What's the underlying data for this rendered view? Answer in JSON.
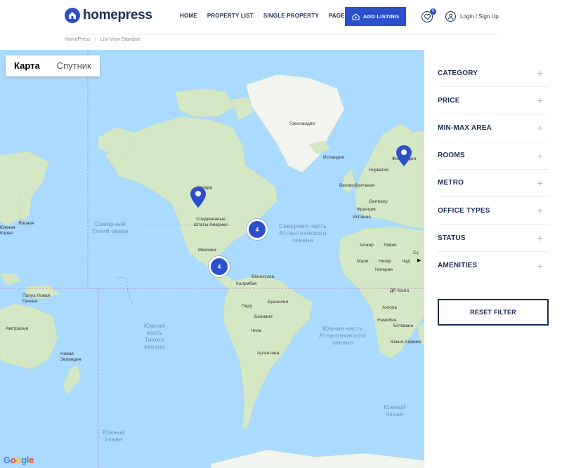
{
  "header": {
    "logo_text": "homepress",
    "nav": [
      "HOME",
      "PROPERTY LIST",
      "SINGLE PROPERTY",
      "PAGES"
    ],
    "add_listing": "ADD LISTING",
    "favorites_count": "0",
    "login": "Login / Sign Up"
  },
  "breadcrumb": {
    "home": "HomePress",
    "current": "List View Standart"
  },
  "map": {
    "type_map": "Карта",
    "type_satellite": "Спутник",
    "google": "Google",
    "labels": {
      "greenland": "Гренландия",
      "iceland": "Исландия",
      "norway": "Норвегия",
      "finland": "Финляндия",
      "uk": "Великобритания",
      "germany": "Germany",
      "france": "Франция",
      "spain": "Испания",
      "algeria": "Алжир",
      "libya": "Ливия",
      "mali": "Мали",
      "niger": "Нигер",
      "chad": "Чад",
      "nigeria": "Нигерия",
      "sudan": "Су",
      "drc": "ДР Конго",
      "angola": "Ангола",
      "namibia": "Намибия",
      "botswana": "Ботсвана",
      "south_africa": "Южно-Африка",
      "canada": "Канада",
      "usa": "Соединенные Штаты Америки",
      "mexico": "Мексика",
      "venezuela": "Венесуэла",
      "colombia": "Колумбия",
      "brazil": "Бразилия",
      "peru": "Перу",
      "bolivia": "Боливия",
      "chile": "Чили",
      "argentina": "Аргентина",
      "japan": "Япония",
      "korea": "Южная Корея",
      "png": "Папуа Новая Гвинея",
      "australia": "Австралия",
      "nz": "Новая Зеландия"
    },
    "oceans": {
      "n_pacific": "Северный Тихий океан",
      "n_atlantic": "Северная часть Атлантического океана",
      "s_pacific": "Южная часть Тихого океана",
      "s_atlantic": "Южная часть Атлантического океана",
      "s_ocean_left": "Южный океан",
      "s_ocean_right": "Южный океан"
    },
    "clusters": [
      {
        "count": "4"
      },
      {
        "count": "4"
      }
    ]
  },
  "filters": [
    "CATEGORY",
    "PRICE",
    "MIN-MAX AREA",
    "ROOMS",
    "METRO",
    "OFFICE TYPES",
    "STATUS",
    "AMENITIES"
  ],
  "reset_filter": "RESET FILTER",
  "colors": {
    "brand": "#2c4fcb",
    "navy": "#1d2b52",
    "ocean": "#aadaff",
    "land": "#d4e8c4"
  }
}
